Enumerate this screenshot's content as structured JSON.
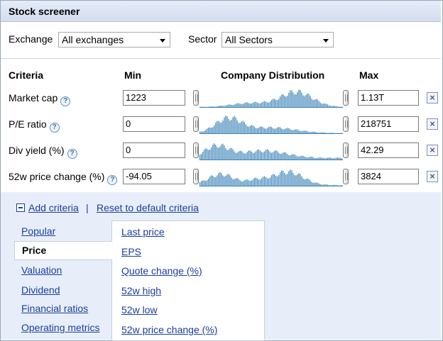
{
  "title": "Stock screener",
  "filters": {
    "exchange_label": "Exchange",
    "exchange_value": "All exchanges",
    "sector_label": "Sector",
    "sector_value": "All Sectors"
  },
  "table_headers": {
    "criteria": "Criteria",
    "min": "Min",
    "distribution": "Company Distribution",
    "max": "Max"
  },
  "criteria_rows": [
    {
      "label": "Market cap",
      "min": "1223",
      "max": "1.13T"
    },
    {
      "label": "P/E ratio",
      "min": "0",
      "max": "218751"
    },
    {
      "label": "Div yield (%)",
      "min": "0",
      "max": "42.29"
    },
    {
      "label": "52w price change (%)",
      "min": "-94.05",
      "max": "3824"
    }
  ],
  "icons": {
    "help": "?",
    "remove": "×"
  },
  "actions": {
    "add_criteria": "Add criteria",
    "separator": "|",
    "reset": "Reset to default criteria"
  },
  "categories": [
    "Popular",
    "Price",
    "Valuation",
    "Dividend",
    "Financial ratios",
    "Operating metrics"
  ],
  "selected_category": "Price",
  "price_options": [
    "Last price",
    "EPS",
    "Quote change (%)",
    "52w high",
    "52w low",
    "52w price change (%)"
  ],
  "colors": {
    "accent_link": "#1a3e9e",
    "histogram_bar": "#3d84b8",
    "panel_bg": "#e8eef9"
  }
}
